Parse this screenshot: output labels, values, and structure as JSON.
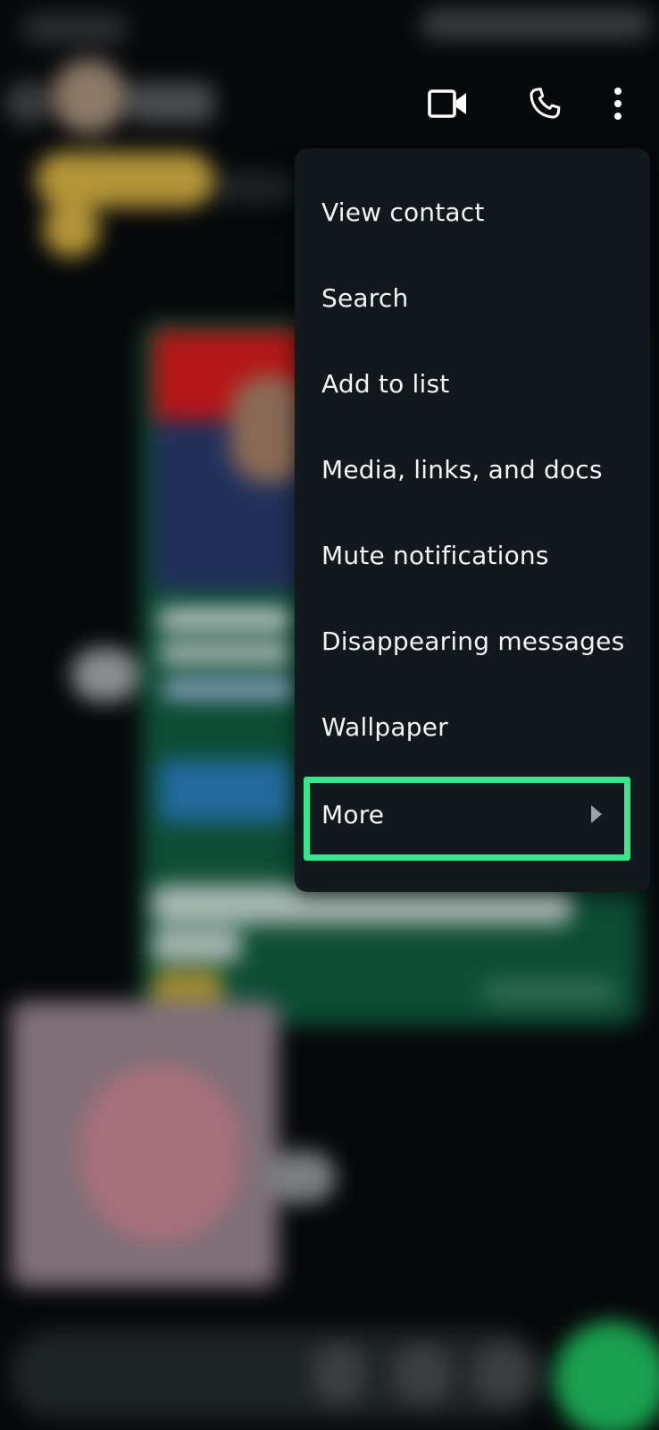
{
  "menu": {
    "items": [
      {
        "label": "View contact"
      },
      {
        "label": "Search"
      },
      {
        "label": "Add to list"
      },
      {
        "label": "Media, links, and docs"
      },
      {
        "label": "Mute notifications"
      },
      {
        "label": "Disappearing messages"
      },
      {
        "label": "Wallpaper"
      },
      {
        "label": "More"
      }
    ],
    "highlight_color": "#37e68c"
  },
  "toolbar": {
    "icons": [
      "video-call-icon",
      "voice-call-icon",
      "more-options-icon"
    ]
  },
  "colors": {
    "menu_background": "#12191c",
    "app_background": "#06080a",
    "menu_text": "#f2f4f5"
  }
}
